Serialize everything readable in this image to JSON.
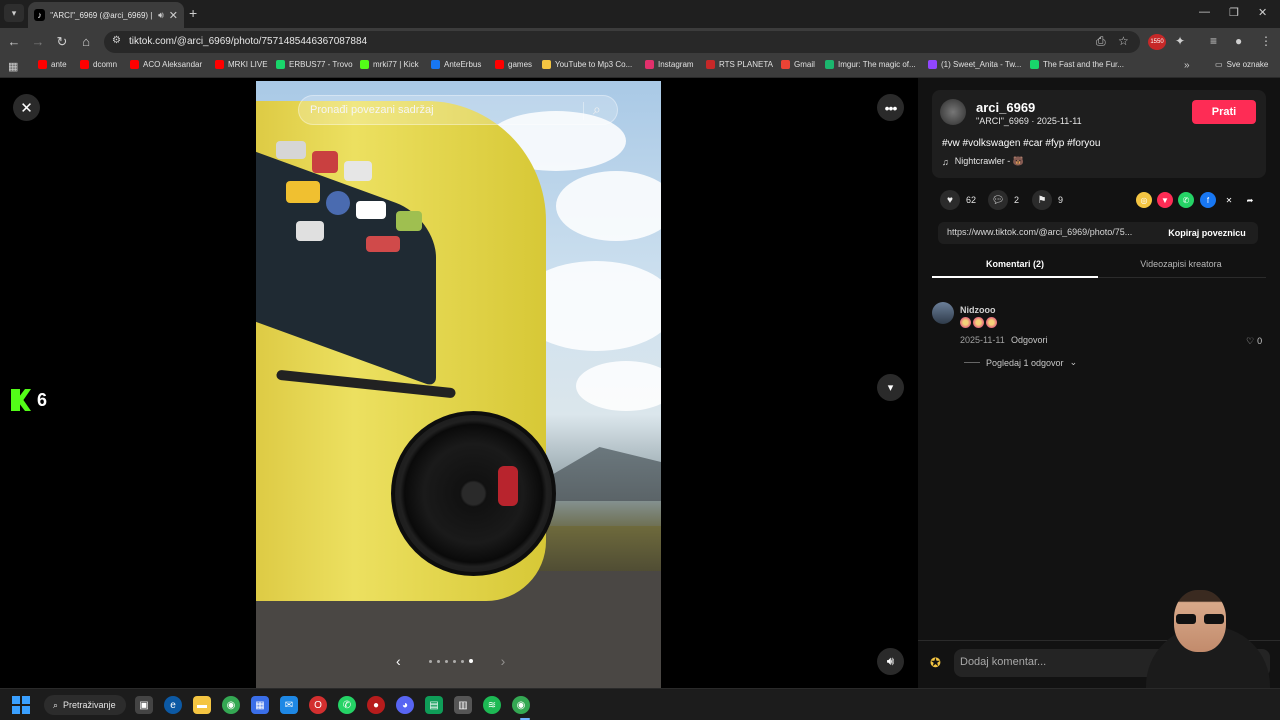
{
  "browser": {
    "tab_title": "\"ARCI\"_6969 (@arci_6969) |",
    "url": "tiktok.com/@arci_6969/photo/7571485446367087884",
    "extension_badge": "1550",
    "bookmarks": [
      {
        "label": "ante",
        "color": "#ff0000"
      },
      {
        "label": "dcomn",
        "color": "#ff0000"
      },
      {
        "label": "ACO Aleksandar",
        "color": "#ff0000"
      },
      {
        "label": "MRKI LIVE",
        "color": "#ff0000"
      },
      {
        "label": "ERBUS77 - Trovo",
        "color": "#19d66b"
      },
      {
        "label": "mrki77 | Kick",
        "color": "#53fc18"
      },
      {
        "label": "AnteErbus",
        "color": "#1877f2"
      },
      {
        "label": "games",
        "color": "#ff0000"
      },
      {
        "label": "YouTube to Mp3 Co...",
        "color": "#f4c542"
      },
      {
        "label": "Instagram",
        "color": "#e1306c"
      },
      {
        "label": "RTS PLANETA",
        "color": "#c62828"
      },
      {
        "label": "Gmail",
        "color": "#ea4335"
      },
      {
        "label": "Imgur: The magic of...",
        "color": "#1bb76e"
      },
      {
        "label": "(1) Sweet_Anita - Tw...",
        "color": "#9146ff"
      },
      {
        "label": "The Fast and the Fur...",
        "color": "#19d66b"
      }
    ],
    "bookmarks_folder": "Sve oznake"
  },
  "viewer": {
    "search_placeholder": "Pronađi povezani sadržaj",
    "kick_count": "6",
    "slide_count": 6,
    "active_slide": 6
  },
  "post": {
    "username": "arci_6969",
    "meta": "\"ARCI\"_6969 · 2025-11-11",
    "follow_label": "Prati",
    "caption": "#vw #volkswagen #car #fyp #foryou",
    "music": "Nightcrawler - 🐻",
    "likes": "62",
    "comments": "2",
    "saves": "9",
    "share_link": "https://www.tiktok.com/@arci_6969/photo/75...",
    "copy_label": "Kopiraj poveznicu",
    "tabs": [
      "Komentari (2)",
      "Videozapisi kreatora"
    ]
  },
  "comment": {
    "user": "Nidzooo",
    "date": "2025-11-11",
    "reply_label": "Odgovori",
    "likes": "0",
    "view_replies": "Pogledaj 1 odgovor"
  },
  "comment_bar": {
    "placeholder": "Dodaj komentar..."
  },
  "taskbar": {
    "search_label": "Pretraživanje"
  },
  "colors": {
    "accent": "#fe2c55",
    "kick_green": "#53fc18"
  }
}
